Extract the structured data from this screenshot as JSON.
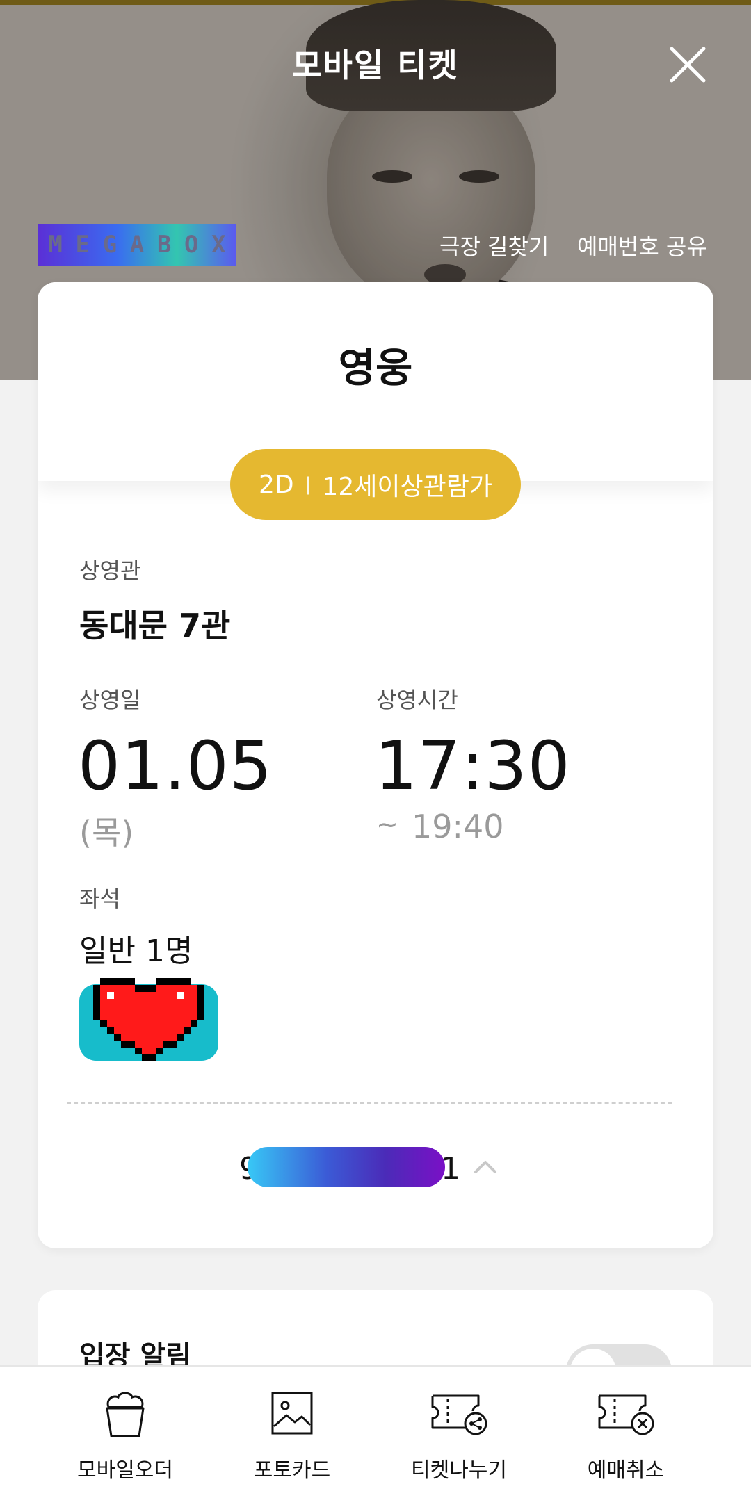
{
  "header": {
    "title": "모바일 티켓",
    "close_icon": "close-icon"
  },
  "brand": {
    "logo_letters": [
      "M",
      "E",
      "G",
      "A",
      "B",
      "O",
      "X"
    ]
  },
  "links": {
    "theater_directions": "극장 길찾기",
    "share_booking_number": "예매번호 공유"
  },
  "ticket": {
    "movie_title": "영웅",
    "format": "2D",
    "separator": "|",
    "rating": "12세이상관람가",
    "screen_label": "상영관",
    "screen_value": "동대문 7관",
    "date_label": "상영일",
    "date_value": "01.05",
    "weekday": "(목)",
    "time_label": "상영시간",
    "time_start": "17:30",
    "time_end_prefix": "~",
    "time_end": "19:40",
    "seat_label": "좌석",
    "seat_value": "일반 1명",
    "code_left_digit": "9",
    "code_right_digit": "1"
  },
  "entry_alert": {
    "title": "입장 알림",
    "toggle_on": false
  },
  "tabbar": {
    "items": [
      {
        "label": "모바일오더",
        "icon": "popcorn-icon"
      },
      {
        "label": "포토카드",
        "icon": "image-icon"
      },
      {
        "label": "티켓나누기",
        "icon": "ticket-share-icon"
      },
      {
        "label": "예매취소",
        "icon": "ticket-cancel-icon"
      }
    ]
  },
  "colors": {
    "pill": "#e5b830",
    "toggle_off": "#e1e1e1",
    "seat_badge": "#17bccb"
  }
}
